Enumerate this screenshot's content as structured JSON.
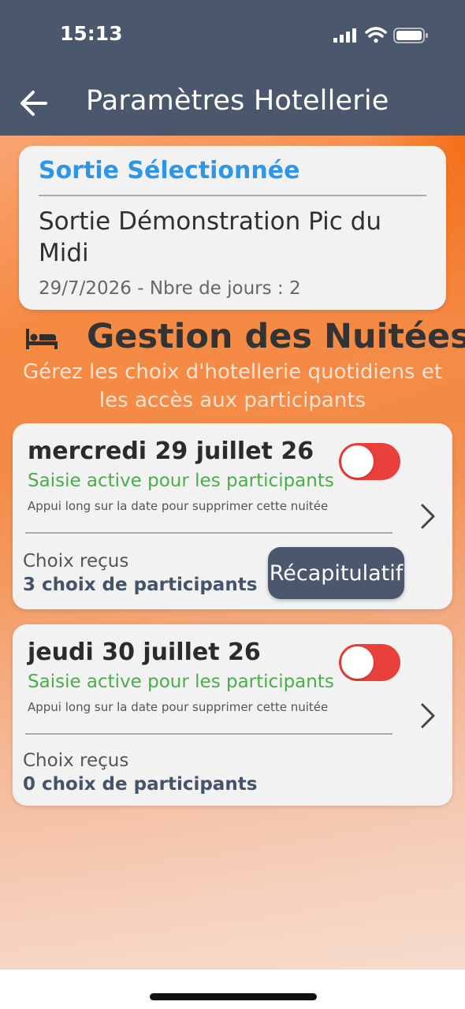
{
  "status_bar": {
    "time": "15:13",
    "icons": [
      "cellular-signal-icon",
      "wifi-icon",
      "battery-icon"
    ]
  },
  "app_bar": {
    "title": "Paramètres Hotellerie",
    "back_icon": "back-arrow-icon"
  },
  "selected_outing": {
    "heading": "Sortie Sélectionnée",
    "name": "Sortie Démonstration Pic du Midi",
    "meta": "29/7/2026 - Nbre de jours : 2"
  },
  "section": {
    "icon": "bed-icon",
    "title": "Gestion des Nuitées",
    "subtitle": "Gérez les choix d'hotellerie quotidiens et les accès aux participants"
  },
  "nights": [
    {
      "date": "mercredi 29 juillet 26",
      "status": "Saisie active pour les participants",
      "hint": "Appui long sur la date pour supprimer cette nuitée",
      "choices_label": "Choix reçus",
      "choices_count": "3 choix de participants",
      "recap_label": "Récapitulatif"
    },
    {
      "date": "jeudi 30 juillet 26",
      "status": "Saisie active pour les participants",
      "hint": "Appui long sur la date pour supprimer cette nuitée",
      "choices_label": "Choix reçus",
      "choices_count": "0 choix de participants"
    }
  ],
  "colors": {
    "app_bar": "#4b576d",
    "accent_blue": "#2f96e6",
    "status_green": "#4aad4a",
    "toggle_red": "#e9403b",
    "gradient_orange": "#f58a43"
  }
}
